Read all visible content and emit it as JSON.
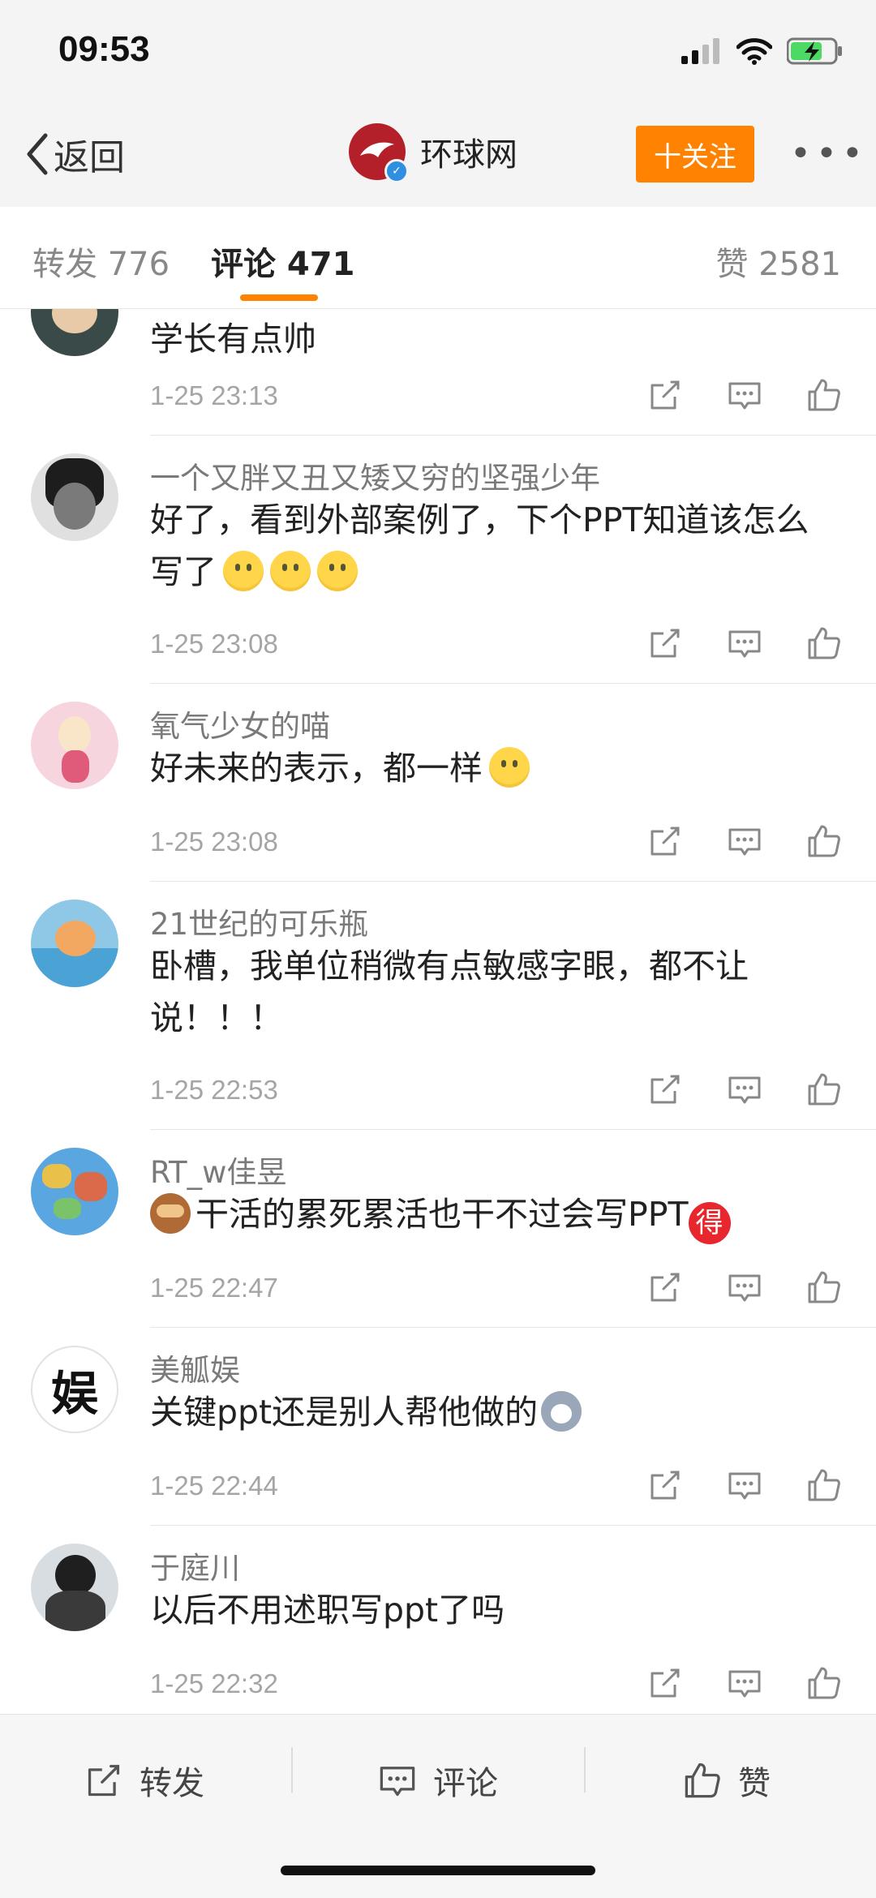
{
  "status_bar": {
    "time": "09:53"
  },
  "nav": {
    "back_label": "返回",
    "account_name": "环球网",
    "follow_label": "十关注",
    "more_label": "•••"
  },
  "tabs": {
    "repost": "转发 776",
    "comment": "评论 471",
    "like": "赞 2581"
  },
  "comments": [
    {
      "user": "",
      "text": "学长有点帅",
      "time": "1-25 23:13"
    },
    {
      "user": "一个又胖又丑又矮又穷的坚强少年",
      "text": "好了，看到外部案例了，下个PPT知道该怎么写了",
      "time": "1-25 23:08"
    },
    {
      "user": "氧气少女的喵",
      "text": "好未来的表示，都一样",
      "time": "1-25 23:08"
    },
    {
      "user": "21世纪的可乐瓶",
      "text": "卧槽，我单位稍微有点敏感字眼，都不让说！！！",
      "time": "1-25 22:53"
    },
    {
      "user": "RT_w佳昱",
      "text": "干活的累死累活也干不过会写PPT",
      "emoji_badge": "得",
      "time": "1-25 22:47"
    },
    {
      "user": "美觚娱",
      "text": "关键ppt还是别人帮他做的",
      "avatar_char": "娱",
      "time": "1-25 22:44"
    },
    {
      "user": "于庭川",
      "text": "以后不用述职写ppt了吗",
      "time": "1-25 22:32"
    }
  ],
  "bottom_bar": {
    "repost": "转发",
    "comment": "评论",
    "like": "赞"
  },
  "colors": {
    "accent": "#ff8200",
    "brand_red": "#b3202a",
    "verified_blue": "#2f8fe0"
  }
}
